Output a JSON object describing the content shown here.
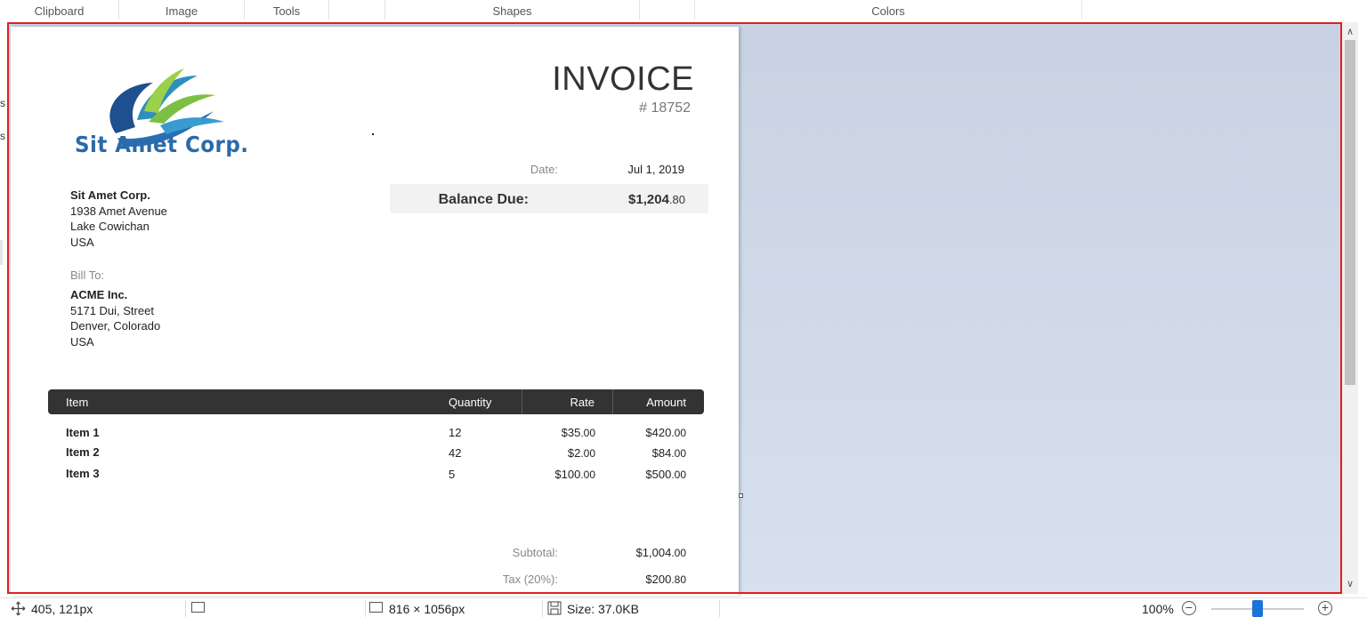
{
  "ribbon": {
    "groups": [
      "Clipboard",
      "Image",
      "Tools",
      "Shapes",
      "Colors"
    ]
  },
  "sidebar_stray": [
    "s",
    "s"
  ],
  "invoice": {
    "logo_text": "Sit Amet Corp.",
    "title": "INVOICE",
    "number": "# 18752",
    "date_label": "Date:",
    "date_value": "Jul 1, 2019",
    "balance_label": "Balance Due:",
    "balance_value_main": "$1,204",
    "balance_value_cents": ".80",
    "from": {
      "name": "Sit Amet Corp.",
      "line1": "1938 Amet Avenue",
      "line2": "Lake Cowichan",
      "line3": "USA"
    },
    "bill_to_label": "Bill To:",
    "to": {
      "name": "ACME Inc.",
      "line1": "5171 Dui, Street",
      "line2": "Denver, Colorado",
      "line3": "USA"
    },
    "columns": [
      "Item",
      "Quantity",
      "Rate",
      "Amount"
    ],
    "rows": [
      {
        "item": "Item 1",
        "qty": "12",
        "rate_main": "$35",
        "rate_cents": ".00",
        "amt_main": "$420",
        "amt_cents": ".00"
      },
      {
        "item": "Item 2",
        "qty": "42",
        "rate_main": "$2",
        "rate_cents": ".00",
        "amt_main": "$84",
        "amt_cents": ".00"
      },
      {
        "item": "Item 3",
        "qty": "5",
        "rate_main": "$100",
        "rate_cents": ".00",
        "amt_main": "$500",
        "amt_cents": ".00"
      }
    ],
    "subtotal_label": "Subtotal:",
    "subtotal_main": "$1,004",
    "subtotal_cents": ".00",
    "tax_label": "Tax (20%):",
    "tax_main": "$200",
    "tax_cents": ".80"
  },
  "status": {
    "cursor_pos": "405, 121px",
    "image_size": "816 × 1056px",
    "file_size": "Size: 37.0KB",
    "zoom": "100%",
    "zoom_level_percent": 100
  },
  "colors": {
    "selection_border": "#e02020",
    "zoom_accent": "#1a73d9",
    "table_header": "#333333"
  }
}
